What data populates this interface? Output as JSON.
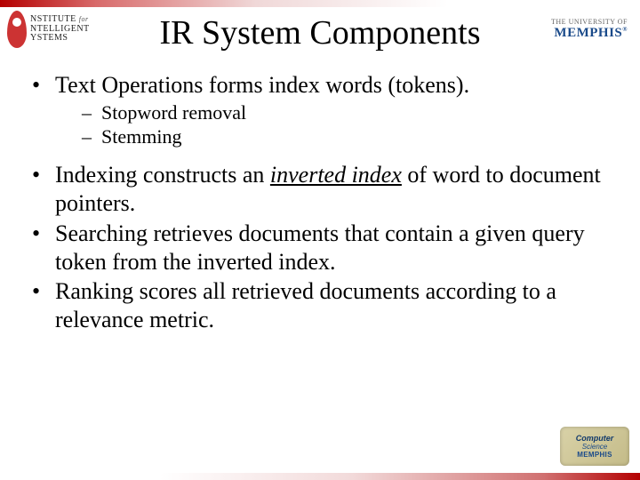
{
  "header": {
    "left_logo": {
      "line1": "NSTITUTE",
      "line2": "for",
      "line3": "NTELLIGENT",
      "line4": "YSTEMS"
    },
    "right_logo": {
      "line1": "THE UNIVERSITY OF",
      "line2": "MEMPHIS"
    }
  },
  "title": "IR System Components",
  "bullets": [
    {
      "text": "Text Operations forms index words (tokens).",
      "sub": [
        {
          "text": "Stopword removal"
        },
        {
          "text": "Stemming"
        }
      ]
    },
    {
      "prefix": "Indexing constructs an ",
      "em": "inverted index",
      "suffix": " of word to document pointers."
    },
    {
      "text": "Searching retrieves documents that contain a given query token from the inverted index."
    },
    {
      "text": "Ranking scores all retrieved documents according to a relevance metric."
    }
  ],
  "footer_logo": {
    "l1": "Computer",
    "l2": "Science",
    "l3": "MEMPHIS"
  }
}
